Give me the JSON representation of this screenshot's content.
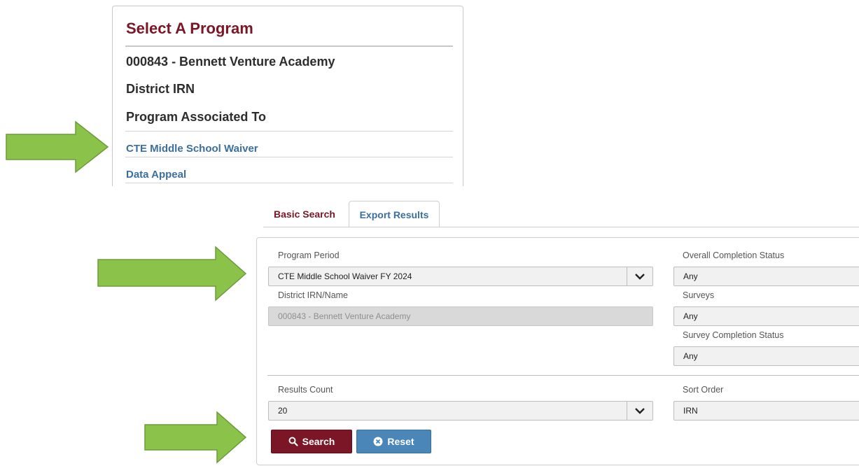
{
  "program_panel": {
    "title": "Select A Program",
    "organization": "000843 - Bennett Venture Academy",
    "district_irn_label": "District IRN",
    "program_associated_label": "Program Associated To",
    "programs": [
      "CTE Middle School Waiver",
      "Data Appeal"
    ]
  },
  "tabs": [
    {
      "label": "Basic Search"
    },
    {
      "label": "Export Results"
    }
  ],
  "search_form": {
    "program_period": {
      "label": "Program Period",
      "value": "CTE Middle School Waiver FY 2024"
    },
    "district_irn": {
      "label": "District IRN/Name",
      "value": "000843 - Bennett Venture Academy"
    },
    "overall_completion": {
      "label": "Overall Completion Status",
      "value": "Any"
    },
    "surveys": {
      "label": "Surveys",
      "value": "Any"
    },
    "survey_completion": {
      "label": "Survey Completion Status",
      "value": "Any"
    },
    "results_count": {
      "label": "Results Count",
      "value": "20"
    },
    "sort_order": {
      "label": "Sort Order",
      "value": "IRN"
    },
    "search_button": "Search",
    "reset_button": "Reset"
  },
  "colors": {
    "brand_maroon": "#7a1626",
    "link_blue": "#3b6f9e",
    "reset_blue": "#4a86b8",
    "arrow_green": "#8bc34a"
  }
}
